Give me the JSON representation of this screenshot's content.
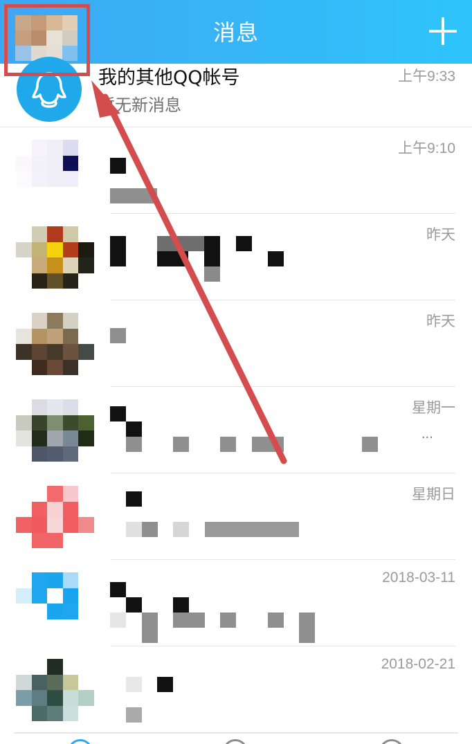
{
  "header": {
    "title": "消息",
    "add_icon": "plus-icon",
    "accent_color": "#35b5f6"
  },
  "conversations": [
    {
      "title": "我的其他QQ帐号",
      "subtitle": "暂无新消息",
      "time": "上午9:33",
      "avatar_icon": "qq-penguin-icon"
    },
    {
      "time": "上午9:10"
    },
    {
      "time": "昨天"
    },
    {
      "time": "昨天"
    },
    {
      "time": "星期一",
      "extra": "..."
    },
    {
      "time": "星期日"
    },
    {
      "time": "2018-03-11"
    },
    {
      "time": "2018-02-21"
    }
  ],
  "annotation": {
    "color": "#d34d4f"
  }
}
